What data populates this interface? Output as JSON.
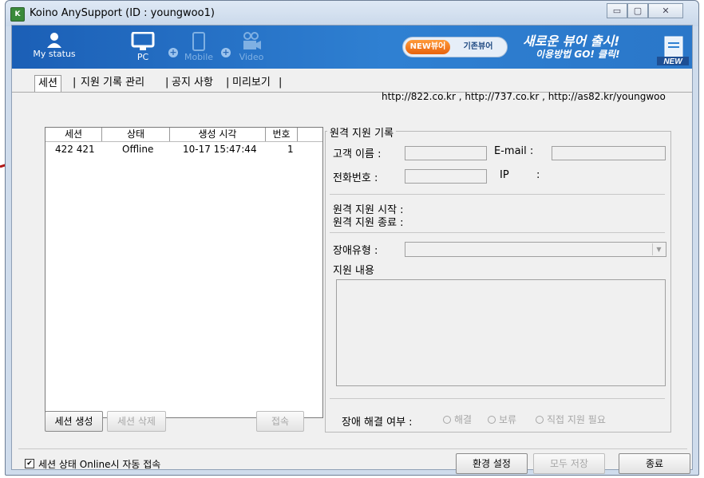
{
  "window": {
    "title": "Koino AnySupport (ID : youngwoo1)",
    "controls": {
      "minimize": "▭",
      "maximize": "▢",
      "close": "✕"
    }
  },
  "banner": {
    "nav": [
      {
        "label": "My status",
        "icon": "person-icon",
        "active": true
      },
      {
        "label": "PC",
        "icon": "monitor-icon",
        "active": true
      },
      {
        "label": "Mobile",
        "icon": "phone-icon",
        "active": false
      },
      {
        "label": "Video",
        "icon": "video-camera-icon",
        "active": false
      }
    ],
    "promo": {
      "new_viewer": "NEW뷰어",
      "old_viewer": "기존뷰어",
      "headline": "새로운 뷰어 출시!",
      "subline": "이용방법 GO! 클릭!",
      "badge": "NEW"
    }
  },
  "tabs": [
    {
      "label": "세션",
      "selected": true
    },
    {
      "label": "지원 기록 관리"
    },
    {
      "label": "공지 사항"
    },
    {
      "label": "미리보기"
    }
  ],
  "tab_separator": "|",
  "urls": "http://822.co.kr , http://737.co.kr , http://as82.kr/youngwoo",
  "session_list": {
    "headers": [
      "세션",
      "상태",
      "생성 시각",
      "번호"
    ],
    "rows": [
      {
        "session": "422 421",
        "status": "Offline",
        "created": "10-17 15:47:44",
        "number": "1"
      }
    ]
  },
  "list_buttons": {
    "create": "세션 생성",
    "delete": "세션 삭제",
    "connect": "접속"
  },
  "record": {
    "title": "원격 지원 기록",
    "customer_name_label": "고객 이름 :",
    "email_label": "E-mail :",
    "phone_label": "전화번호 :",
    "ip_label": "IP",
    "ip_colon": ":",
    "start_label": "원격 지원 시작 :",
    "end_label": "원격 지원 종료 :",
    "fault_type_label": "장애유형 :",
    "support_content_label": "지원 내용",
    "resolved_label": "장애 해결 여부 :",
    "radio_options": [
      "해결",
      "보류",
      "직접 지원 필요"
    ]
  },
  "footer": {
    "auto_connect_label": "세션 상태 Online시 자동 접속",
    "auto_connect_checked": true,
    "settings": "환경 설정",
    "save_all": "모두 저장",
    "exit": "종료"
  },
  "colors": {
    "banner_blue": "#1b5fb6",
    "promo_orange": "#e8620c",
    "arrow_red": "#b01818",
    "window_frame": "#cfdcec"
  }
}
